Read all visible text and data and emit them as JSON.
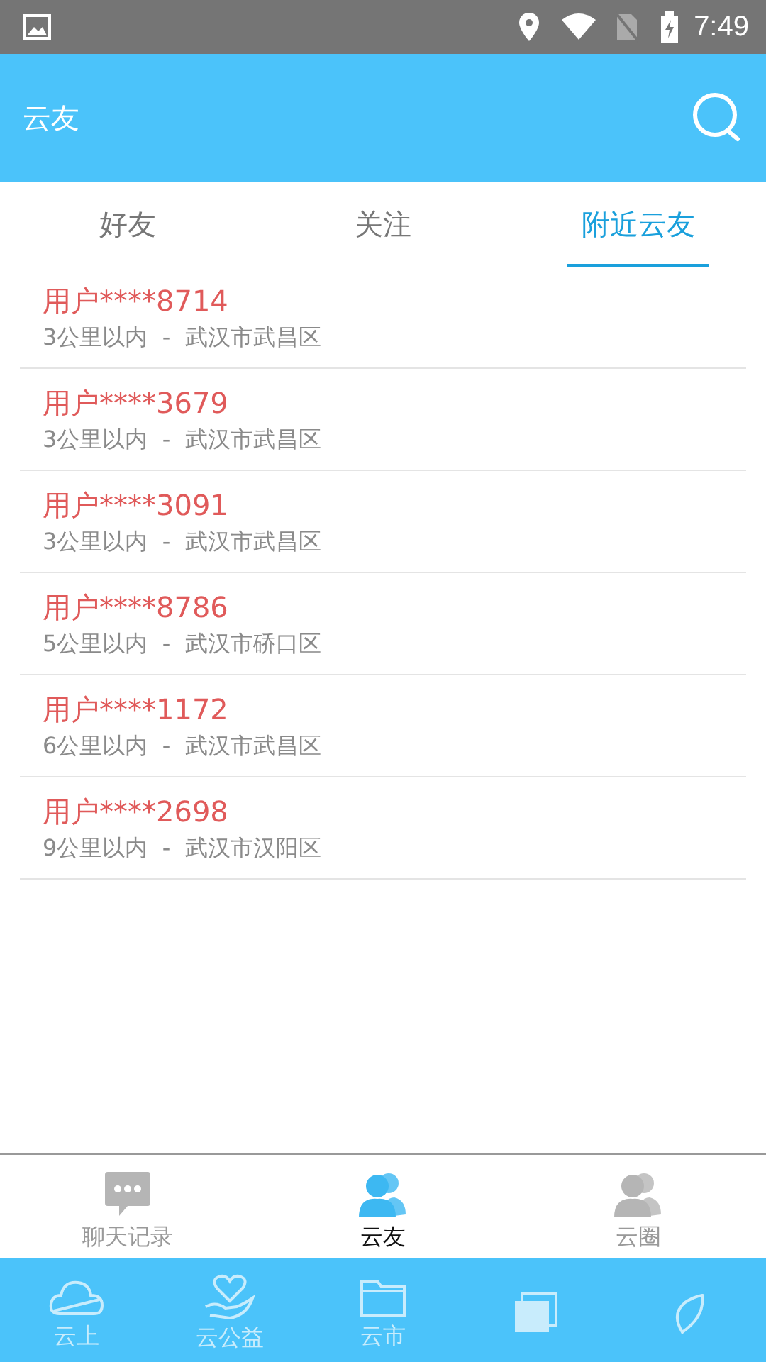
{
  "status_bar": {
    "time": "7:49"
  },
  "header": {
    "title": "云友"
  },
  "tabs": [
    {
      "label": "好友",
      "selected": false
    },
    {
      "label": "关注",
      "selected": false
    },
    {
      "label": "附近云友",
      "selected": true
    }
  ],
  "users": [
    {
      "name": "用户****8714",
      "distance": "3公里以内",
      "separator": "-",
      "area": "武汉市武昌区"
    },
    {
      "name": "用户****3679",
      "distance": "3公里以内",
      "separator": "-",
      "area": "武汉市武昌区"
    },
    {
      "name": "用户****3091",
      "distance": "3公里以内",
      "separator": "-",
      "area": "武汉市武昌区"
    },
    {
      "name": "用户****8786",
      "distance": "5公里以内",
      "separator": "-",
      "area": "武汉市硚口区"
    },
    {
      "name": "用户****1172",
      "distance": "6公里以内",
      "separator": "-",
      "area": "武汉市武昌区"
    },
    {
      "name": "用户****2698",
      "distance": "9公里以内",
      "separator": "-",
      "area": "武汉市汉阳区"
    }
  ],
  "sub_nav": [
    {
      "kind": "chat",
      "label": "聊天记录",
      "selected": false
    },
    {
      "kind": "friends",
      "label": "云友",
      "selected": true
    },
    {
      "kind": "circle",
      "label": "云圈",
      "selected": false
    }
  ],
  "main_nav": [
    {
      "kind": "cloud",
      "label": "云上"
    },
    {
      "kind": "charity",
      "label": "云公益"
    },
    {
      "kind": "market",
      "label": "云市"
    },
    {
      "kind": "cards"
    },
    {
      "kind": "leaf"
    }
  ]
}
